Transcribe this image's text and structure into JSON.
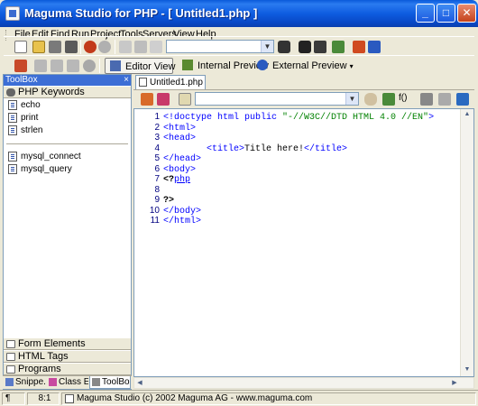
{
  "window": {
    "title": "Maguma Studio for PHP - [ Untitled1.php ]",
    "minimize_glyph": "_",
    "maximize_glyph": "□",
    "close_glyph": "✕"
  },
  "menu": {
    "items": [
      "File",
      "Edit",
      "Find",
      "Run",
      "Project",
      "Tools",
      "Servers",
      "View",
      "Help"
    ]
  },
  "toolbar": {
    "search_value": "",
    "view_buttons": [
      "Editor View",
      "Internal Preview",
      "External Preview"
    ]
  },
  "toolbox": {
    "title": "ToolBox",
    "close_glyph": "×",
    "group_php": "PHP Keywords",
    "items": [
      "echo",
      "print",
      "strlen",
      "mysql_connect",
      "mysql_query"
    ],
    "groups_bottom": [
      "Form Elements",
      "HTML Tags",
      "Programs"
    ],
    "tabs": [
      "Snippe...",
      "Class E...",
      "ToolBox"
    ]
  },
  "editor": {
    "doc_tab": "Untitled1.php",
    "function_dropdown_value": "",
    "func_button_label": "f()",
    "lines": [
      {
        "num": "1",
        "html": "<span style='color:#0000ff'>&lt;!doctype html public </span><span style='color:#008000'>\"-//W3C//DTD HTML 4.0 //EN\"</span><span style='color:#0000ff'>&gt;</span>"
      },
      {
        "num": "2",
        "html": "<span style='color:#0000ff'>&lt;html&gt;</span>"
      },
      {
        "num": "3",
        "html": "<span style='color:#0000ff'>&lt;head&gt;</span>"
      },
      {
        "num": "4",
        "html": "        <span style='color:#0000ff'>&lt;title&gt;</span>Title here!<span style='color:#0000ff'>&lt;/title&gt;</span>"
      },
      {
        "num": "5",
        "html": "<span style='color:#0000ff'>&lt;/head&gt;</span>"
      },
      {
        "num": "6",
        "html": "<span style='color:#0000ff'>&lt;body&gt;</span>"
      },
      {
        "num": "7",
        "html": "<b style='color:#000'>&lt;?</b><span style='color:#0000ff;text-decoration:underline'>php</span>"
      },
      {
        "num": "8",
        "html": ""
      },
      {
        "num": "9",
        "html": "<b style='color:#000'>?&gt;</b>"
      },
      {
        "num": "10",
        "html": "<span style='color:#0000ff'>&lt;/body&gt;</span>"
      },
      {
        "num": "11",
        "html": "<span style='color:#0000ff'>&lt;/html&gt;</span>"
      }
    ]
  },
  "status": {
    "pilcrow": "¶",
    "position": "8:1",
    "message": "Maguma Studio (c) 2002 Maguma AG - www.maguma.com"
  }
}
